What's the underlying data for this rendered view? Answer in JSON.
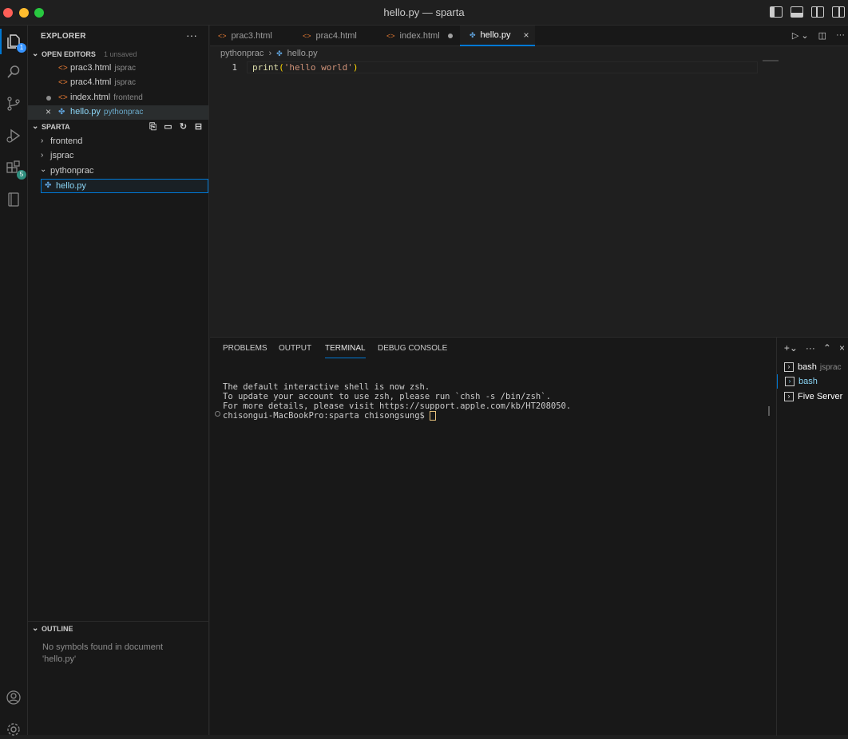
{
  "window": {
    "title": "hello.py — sparta"
  },
  "activity": {
    "explorer_badge": "1",
    "extensions_badge": "5"
  },
  "sidebar": {
    "title": "EXPLORER",
    "more": "···",
    "open_editors": {
      "label": "OPEN EDITORS",
      "status": "1 unsaved",
      "items": [
        {
          "name": "prac3.html",
          "folder": "jsprac"
        },
        {
          "name": "prac4.html",
          "folder": "jsprac"
        },
        {
          "name": "index.html",
          "folder": "frontend"
        },
        {
          "name": "hello.py",
          "folder": "pythonprac"
        }
      ]
    },
    "workspace": {
      "label": "SPARTA",
      "folders": [
        "frontend",
        "jsprac",
        "pythonprac"
      ],
      "file": "hello.py"
    },
    "outline": {
      "label": "OUTLINE",
      "message": "No symbols found in document 'hello.py'"
    }
  },
  "tabs": [
    {
      "name": "prac3.html"
    },
    {
      "name": "prac4.html"
    },
    {
      "name": "index.html"
    },
    {
      "name": "hello.py"
    }
  ],
  "breadcrumb": {
    "folder": "pythonprac",
    "file": "hello.py"
  },
  "editor": {
    "line_number": "1",
    "code_fn": "print",
    "code_open": "(",
    "code_str": "'hello world'",
    "code_close": ")"
  },
  "panel": {
    "tabs": [
      "PROBLEMS",
      "OUTPUT",
      "TERMINAL",
      "DEBUG CONSOLE"
    ],
    "terminal_lines": [
      "The default interactive shell is now zsh.",
      "To update your account to use zsh, please run `chsh -s /bin/zsh`.",
      "For more details, please visit https://support.apple.com/kb/HT208050.",
      "chisongui-MacBookPro:sparta chisongsung$ "
    ],
    "terminals": [
      {
        "name": "bash",
        "extra": "jsprac"
      },
      {
        "name": "bash",
        "extra": ""
      },
      {
        "name": "Five Server",
        "extra": ""
      }
    ]
  }
}
